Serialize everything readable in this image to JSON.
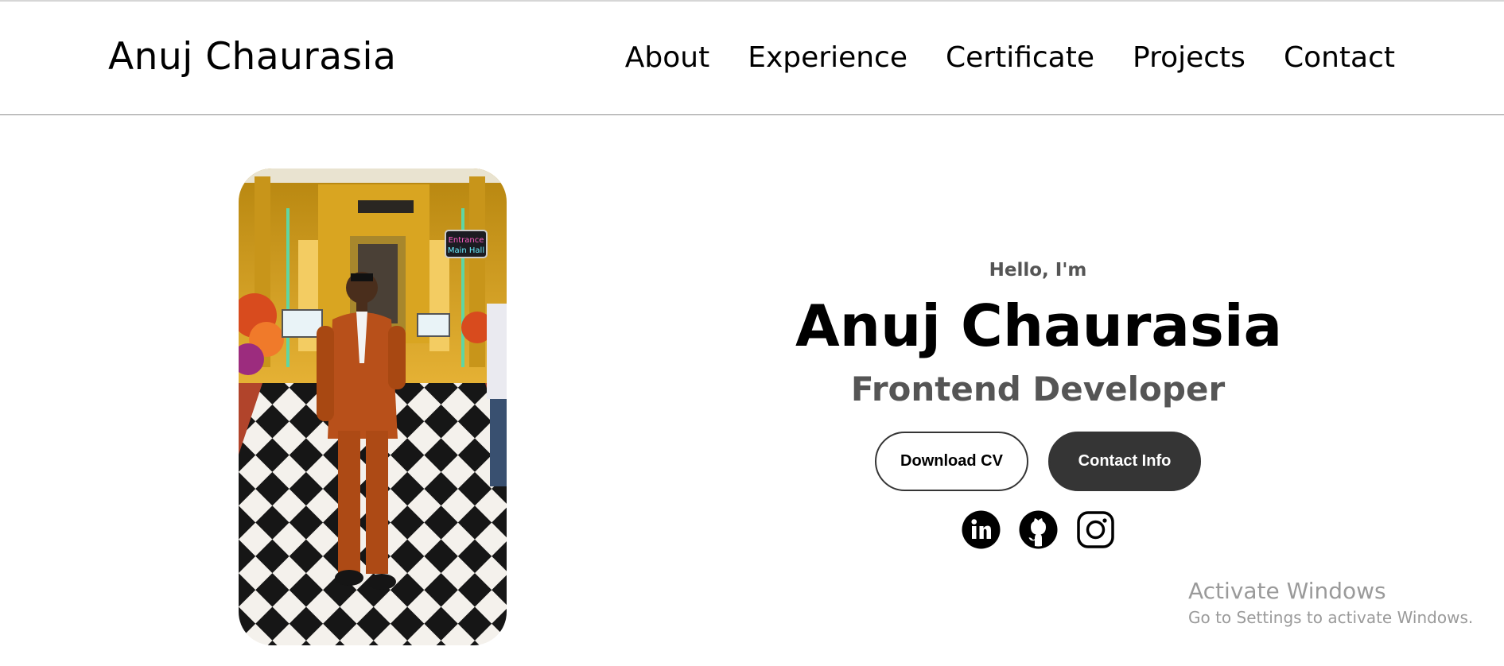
{
  "header": {
    "logo": "Anuj Chaurasia",
    "nav": [
      "About",
      "Experience",
      "Certificate",
      "Projects",
      "Contact"
    ]
  },
  "hero": {
    "greeting": "Hello, I'm",
    "name": "Anuj Chaurasia",
    "role": "Frontend Developer",
    "download_cv": "Download CV",
    "contact_info": "Contact Info",
    "socials": [
      "linkedin-icon",
      "github-icon",
      "instagram-icon"
    ],
    "photo": "profile photo of a man in an orange suit standing on a checkered floor in a decorated hall",
    "photo_sign": [
      "Entrance",
      "Main Hall"
    ]
  },
  "watermark": {
    "title": "Activate Windows",
    "subtitle": "Go to Settings to activate Windows."
  },
  "colors": {
    "text_primary": "#000000",
    "text_secondary": "#555555",
    "button_dark": "#353535",
    "divider": "#8c8c8c",
    "watermark": "#9a9a9a"
  }
}
